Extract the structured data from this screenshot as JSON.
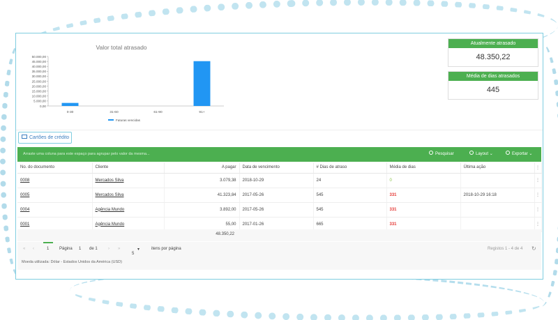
{
  "chart_data": {
    "type": "bar",
    "title": "Valor total atrasado",
    "categories": [
      "0-30",
      "31-60",
      "61-90",
      "91+"
    ],
    "series": [
      {
        "name": "Faturas vencidas",
        "values": [
          3079.38,
          0,
          0,
          45270.84
        ]
      }
    ],
    "ylim": [
      0,
      50000
    ],
    "yticks": [
      "0,00",
      "5.000,00",
      "10.000,00",
      "15.000,00",
      "20.000,00",
      "25.000,00",
      "30.000,00",
      "35.000,00",
      "40.000,00",
      "45.000,00",
      "50.000,00"
    ],
    "legend_position": "bottom",
    "bar_color": "#2196f3"
  },
  "stats": {
    "overdue_label": "Atualmente atrasado",
    "overdue_value": "48.350,22",
    "avg_days_label": "Média de dias atrasados",
    "avg_days_value": "445"
  },
  "tab": {
    "label": "Cartões de crédito"
  },
  "groupbar": {
    "hint": "Arraste uma coluna para este espaço para agrupar pelo valor da mesma...",
    "search": "Pesquisar",
    "layout": "Layout",
    "export": "Exportar"
  },
  "columns": [
    "No. do documento",
    "Cliente",
    "A pagar",
    "Data de vencimento",
    "# Dias de atraso",
    "Média de dias",
    "Última ação"
  ],
  "rows": [
    {
      "doc": "0008",
      "client": "Mercados Silva",
      "amount": "3.079,38",
      "due": "2018-10-29",
      "days": "24",
      "avg": "0",
      "last": ""
    },
    {
      "doc": "0005",
      "client": "Mercados Silva",
      "amount": "41.323,84",
      "due": "2017-05-26",
      "days": "545",
      "avg": "331",
      "last": "2018-10-29 16:18"
    },
    {
      "doc": "0004",
      "client": "Agência Mundo",
      "amount": "3.892,00",
      "due": "2017-05-26",
      "days": "545",
      "avg": "331",
      "last": ""
    },
    {
      "doc": "0001",
      "client": "Agência Mundo",
      "amount": "55,00",
      "due": "2017-01-26",
      "days": "665",
      "avg": "331",
      "last": ""
    }
  ],
  "total": "48.350,22",
  "pager": {
    "first": "«",
    "prev": "‹",
    "page_num": "1",
    "next": "›",
    "last": "»",
    "page_label": "Página",
    "page_input": "1",
    "of_label": "de 1",
    "per_page": "5",
    "per_page_label": "itens por página",
    "records": "Registos 1 - 4 de 4"
  },
  "currency_note": "Moeda utilizada: Dólar - Estados Unidos da América (USD)"
}
